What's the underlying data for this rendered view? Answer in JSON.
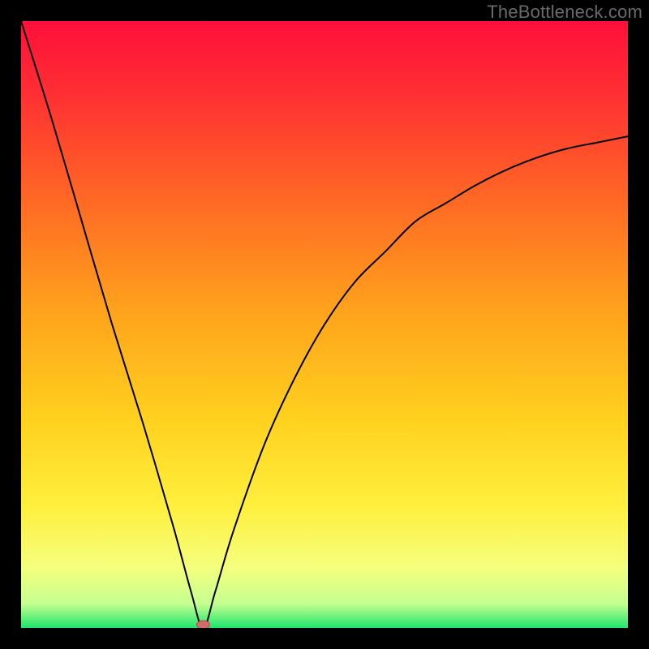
{
  "watermark": "TheBottleneck.com",
  "colors": {
    "gradient": [
      {
        "offset": "0%",
        "color": "#ff0f3a"
      },
      {
        "offset": "12%",
        "color": "#ff2f33"
      },
      {
        "offset": "30%",
        "color": "#ff6a24"
      },
      {
        "offset": "48%",
        "color": "#ffa31c"
      },
      {
        "offset": "66%",
        "color": "#ffd21e"
      },
      {
        "offset": "80%",
        "color": "#ffef3e"
      },
      {
        "offset": "90%",
        "color": "#f5ff7d"
      },
      {
        "offset": "96%",
        "color": "#c5ff90"
      },
      {
        "offset": "100%",
        "color": "#1fe56d"
      }
    ],
    "curve": "#000000",
    "marker_fill": "#d46a6a",
    "marker_stroke": "#b24c4c"
  },
  "chart_data": {
    "type": "line",
    "title": "",
    "xlabel": "",
    "ylabel": "",
    "xlim": [
      0,
      100
    ],
    "ylim": [
      0,
      100
    ],
    "description": "Bottleneck percentage curve with vertical gradient background (red=top/high bottleneck to green=bottom/low bottleneck). Single black curve reaching minimum near x≈30, with a small marker at the minimum (on the green baseline).",
    "series": [
      {
        "name": "bottleneck-curve",
        "x": [
          0,
          5,
          10,
          15,
          20,
          25,
          28,
          30,
          32,
          35,
          40,
          45,
          50,
          55,
          60,
          65,
          70,
          75,
          80,
          85,
          90,
          95,
          100
        ],
        "y": [
          100,
          84,
          67,
          50,
          34,
          17,
          6,
          0,
          6,
          16,
          30,
          41,
          50,
          57,
          62,
          67,
          70,
          73,
          75.5,
          77.5,
          79,
          80,
          81
        ]
      }
    ],
    "marker": {
      "x": 30,
      "y": 0
    }
  }
}
